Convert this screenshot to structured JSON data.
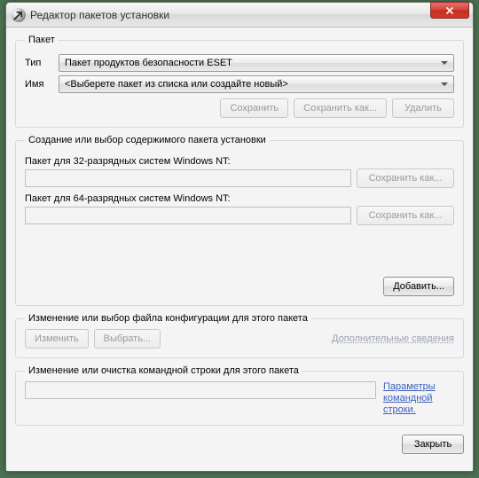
{
  "window": {
    "title": "Редактор пакетов установки"
  },
  "package": {
    "legend": "Пакет",
    "type_label": "Тип",
    "type_value": "Пакет продуктов безопасности ESET",
    "name_label": "Имя",
    "name_value": "<Выберете пакет из списка или создайте новый>",
    "save": "Сохранить",
    "save_as": "Сохранить как...",
    "delete": "Удалить"
  },
  "contents": {
    "legend": "Создание или выбор содержимого пакета установки",
    "nt32_label": "Пакет для 32-разрядных систем Windows NT:",
    "nt32_value": "",
    "nt32_saveas": "Сохранить как...",
    "nt64_label": "Пакет для 64-разрядных систем Windows NT:",
    "nt64_value": "",
    "nt64_saveas": "Сохранить как...",
    "add": "Добавить..."
  },
  "config": {
    "legend": "Изменение или выбор файла конфигурации для этого пакета",
    "edit": "Изменить",
    "select": "Выбрать...",
    "more_info": "Дополнительные сведения"
  },
  "cmdline": {
    "legend": "Изменение или очистка командной строки для этого пакета",
    "value": "",
    "params_link": "Параметры командной строки."
  },
  "footer": {
    "close": "Закрыть"
  }
}
